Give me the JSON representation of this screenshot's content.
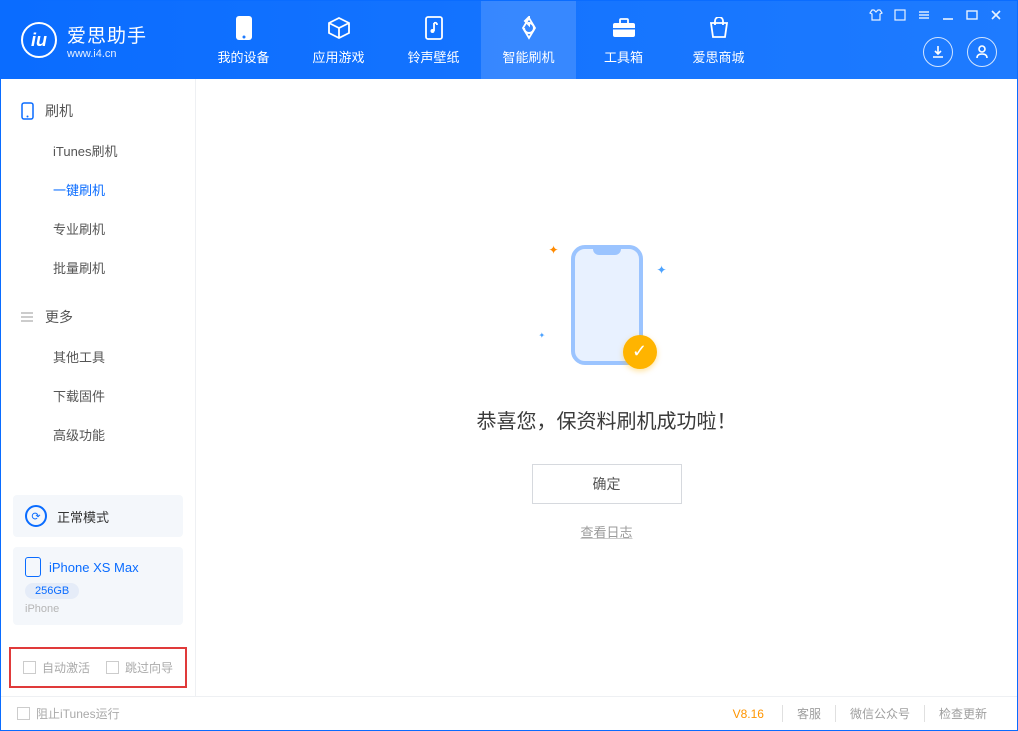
{
  "app": {
    "title": "爱思助手",
    "subtitle": "www.i4.cn"
  },
  "nav": {
    "tabs": [
      {
        "label": "我的设备",
        "icon": "device"
      },
      {
        "label": "应用游戏",
        "icon": "cube"
      },
      {
        "label": "铃声壁纸",
        "icon": "music"
      },
      {
        "label": "智能刷机",
        "icon": "refresh"
      },
      {
        "label": "工具箱",
        "icon": "toolbox"
      },
      {
        "label": "爱思商城",
        "icon": "shop"
      }
    ],
    "active_index": 3
  },
  "sidebar": {
    "group1": {
      "title": "刷机",
      "items": [
        "iTunes刷机",
        "一键刷机",
        "专业刷机",
        "批量刷机"
      ],
      "active_index": 1
    },
    "group2": {
      "title": "更多",
      "items": [
        "其他工具",
        "下载固件",
        "高级功能"
      ]
    },
    "mode": {
      "label": "正常模式"
    },
    "device": {
      "name": "iPhone XS Max",
      "storage": "256GB",
      "type": "iPhone"
    },
    "checkbox1": "自动激活",
    "checkbox2": "跳过向导"
  },
  "main": {
    "success_text": "恭喜您，保资料刷机成功啦！",
    "ok_button": "确定",
    "log_link": "查看日志"
  },
  "footer": {
    "stop_itunes": "阻止iTunes运行",
    "version": "V8.16",
    "links": [
      "客服",
      "微信公众号",
      "检查更新"
    ]
  }
}
